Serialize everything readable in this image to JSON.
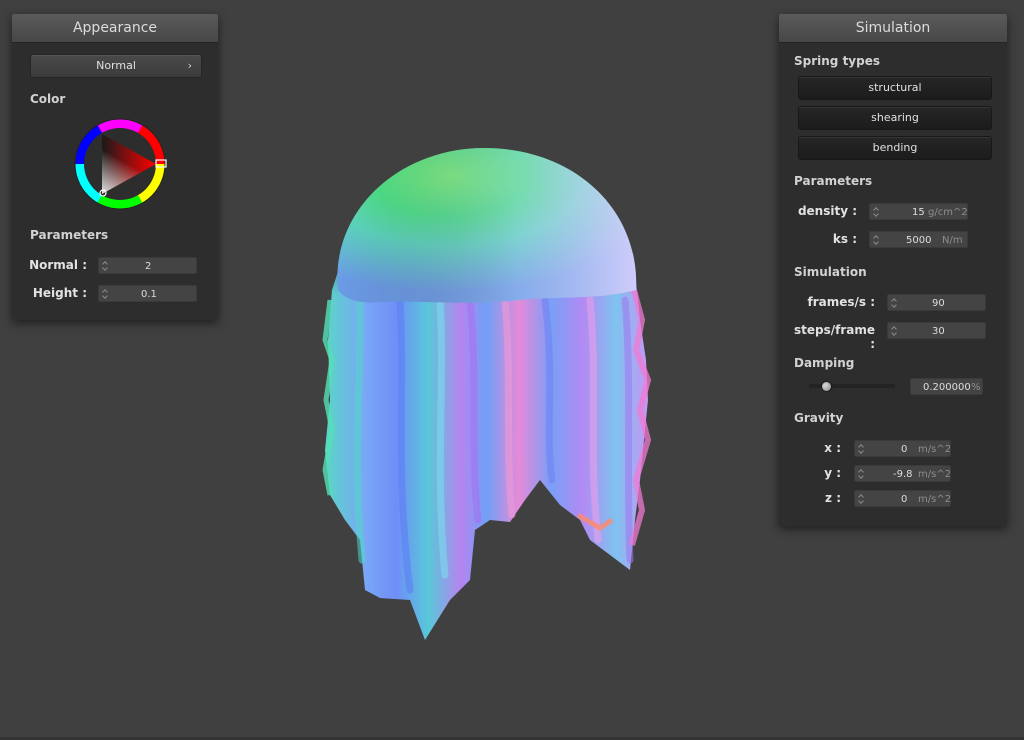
{
  "appearance": {
    "title": "Appearance",
    "shader": "Normal",
    "color_label": "Color",
    "parameters_label": "Parameters",
    "normal_label": "Normal :",
    "normal_value": "2",
    "height_label": "Height :",
    "height_value": "0.1",
    "selected_color": "#ff0000"
  },
  "simulation": {
    "title": "Simulation",
    "spring_types_label": "Spring types",
    "spring_buttons": [
      "structural",
      "shearing",
      "bending"
    ],
    "parameters_label": "Parameters",
    "density_label": "density :",
    "density_value": "15",
    "density_unit": "g/cm^2",
    "ks_label": "ks :",
    "ks_value": "5000",
    "ks_unit": "N/m",
    "sim_label": "Simulation",
    "fps_label": "frames/s :",
    "fps_value": "90",
    "steps_label": "steps/frame :",
    "steps_value": "30",
    "damping_label": "Damping",
    "damping_value": "0.200000",
    "damping_unit": "%",
    "damping_fraction": 0.2,
    "gravity_label": "Gravity",
    "gx_label": "x :",
    "gx_value": "0",
    "gx_unit": "m/s^2",
    "gy_label": "y :",
    "gy_value": "-9.8",
    "gy_unit": "m/s^2",
    "gz_label": "z :",
    "gz_value": "0",
    "gz_unit": "m/s^2"
  }
}
